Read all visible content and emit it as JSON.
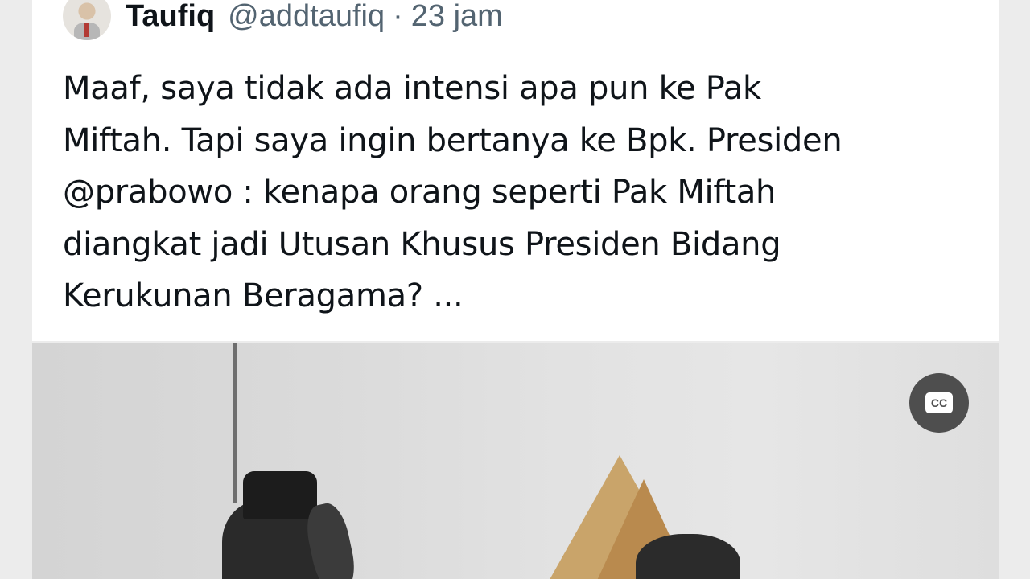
{
  "tweet": {
    "author_name": "Taufiq",
    "author_handle": "@addtaufiq",
    "separator": "·",
    "time": "23 jam",
    "text_lines": [
      "Maaf, saya tidak ada intensi apa pun ke Pak",
      "Miftah. Tapi saya ingin bertanya ke Bpk. Presiden",
      "@prabowo : kenapa orang seperti Pak Miftah",
      "diangkat jadi Utusan Khusus Presiden Bidang",
      "Kerukunan Beragama? ..."
    ]
  },
  "media": {
    "cc_label": "CC",
    "cc_icon": "closed-captions-icon"
  },
  "colors": {
    "text_primary": "#0f1419",
    "text_secondary": "#536471",
    "cc_button_bg": "#4e4e4e"
  }
}
